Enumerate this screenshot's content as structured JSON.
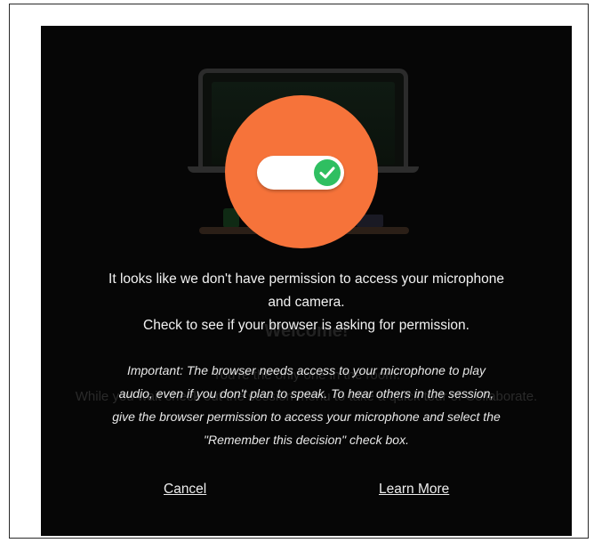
{
  "background": {
    "title": "Welcome!",
    "subtitle_line1": "You're the only one in the room.",
    "subtitle_line2": "While you wait check out the session menu to take a quick tour of Collaborate."
  },
  "badge": {
    "icon": "toggle-on-check-icon",
    "color": "#f6733a",
    "toggle_color": "#2fbf61"
  },
  "dialog": {
    "message_line1": "It looks like we don't have permission to access your microphone",
    "message_line2": "and camera.",
    "message_line3": "Check to see if your browser is asking for permission.",
    "important_lines": [
      "Important: The browser needs access to your microphone to play",
      "audio, even if you don't plan to speak. To hear others in the session,",
      "give the browser permission to access your microphone and select the",
      "\"Remember this decision\" check box."
    ],
    "cancel_label": "Cancel",
    "learn_more_label": "Learn More"
  }
}
